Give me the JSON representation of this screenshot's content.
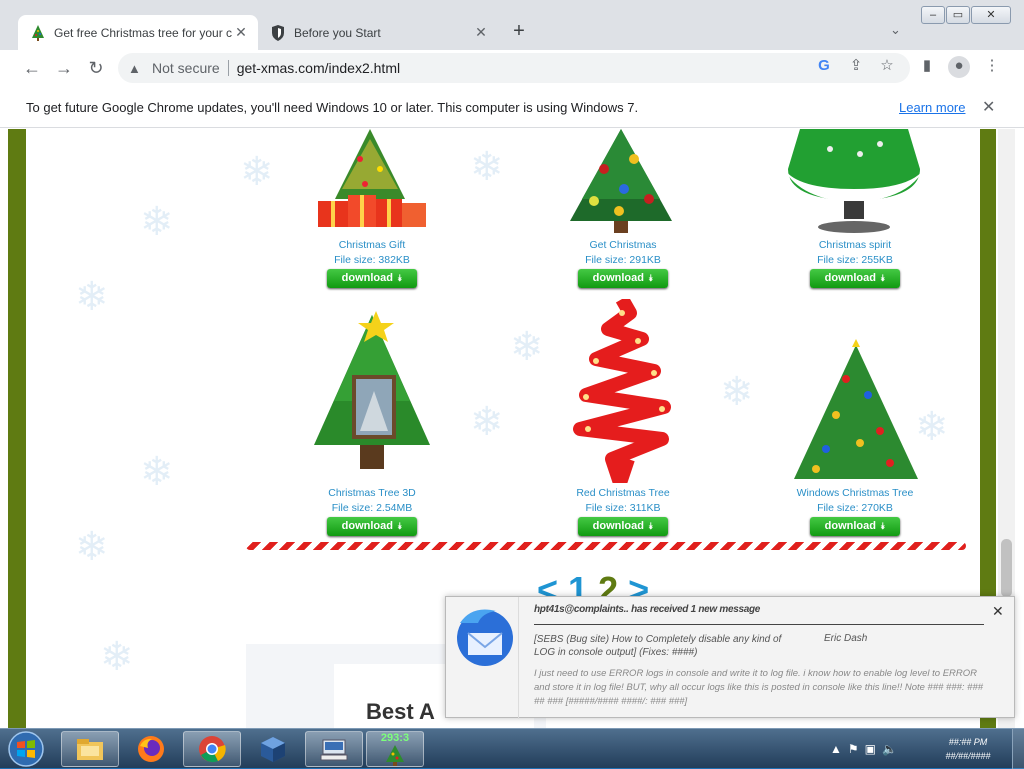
{
  "browser": {
    "tabs": [
      {
        "title": "Get free Christmas tree for your c",
        "active": true,
        "icon": "christmas-tree-icon"
      },
      {
        "title": "Before you Start",
        "active": false,
        "icon": "shield-icon"
      }
    ],
    "new_tab": "+",
    "address": {
      "security": "Not secure",
      "url": "get-xmas.com/index2.html"
    },
    "infobar": {
      "message": "To get future Google Chrome updates, you'll need Windows 10 or later. This computer is using Windows 7.",
      "link": "Learn more"
    }
  },
  "products": [
    {
      "name": "Christmas Gift",
      "size": "File size: 382KB",
      "download": "download"
    },
    {
      "name": "Get Christmas",
      "size": "File size: 291KB",
      "download": "download"
    },
    {
      "name": "Christmas spirit",
      "size": "File size: 255KB",
      "download": "download"
    },
    {
      "name": "Christmas Tree 3D",
      "size": "File size: 2.54MB",
      "download": "download"
    },
    {
      "name": "Red Christmas Tree",
      "size": "File size: 311KB",
      "download": "download"
    },
    {
      "name": "Windows Christmas Tree",
      "size": "File size: 270KB",
      "download": "download"
    }
  ],
  "pagination": {
    "prev": "<",
    "page1": "1",
    "page2": "2",
    "next": ">"
  },
  "section_title": "Best A",
  "notification": {
    "title": "hpt41s@complaints.. has received 1 new message",
    "subject": "[SEBS (Bug site) How to Completely disable any kind of LOG in console output] (Fixes: ####)",
    "from": "Eric Dash",
    "body": "I just need to use ERROR logs in console and write it to log file. i know how to enable log level to ERROR and store it in log file! BUT, why all occur logs like this is posted in console like this line!! Note ### ###: ### ## ### [#####/#### ####/: ### ###]",
    "close": "✕"
  },
  "taskbar": {
    "items": [
      "windows-start",
      "file-explorer",
      "firefox",
      "chrome",
      "virtualbox",
      "keyboard-app",
      "tree-counter"
    ],
    "counter": "293:3",
    "clock_time": "##:## PM",
    "clock_date": "##/##/####"
  },
  "colors": {
    "accent_green": "#5f7b12",
    "link_blue": "#2a8fc7",
    "download_green": "#1aa81a",
    "pager_blue": "#1f95d3"
  }
}
